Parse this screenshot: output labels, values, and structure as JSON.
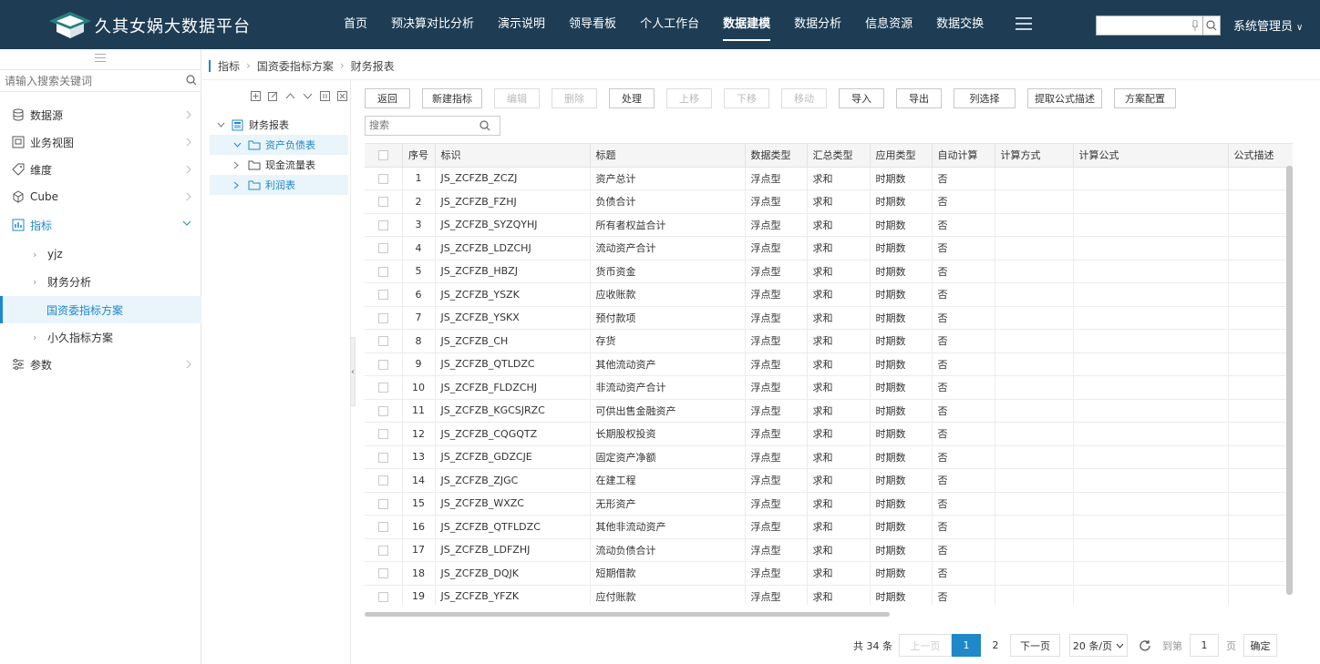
{
  "app": {
    "title": "久其女娲大数据平台"
  },
  "nav": {
    "items": [
      "首页",
      "预决算对比分析",
      "演示说明",
      "领导看板",
      "个人工作台",
      "数据建模",
      "数据分析",
      "信息资源",
      "数据交换"
    ]
  },
  "header": {
    "search_placeholder": "",
    "user": "系统管理员"
  },
  "sidebar": {
    "search_placeholder": "请输入搜索关键词",
    "items": [
      "数据源",
      "业务视图",
      "维度",
      "Cube",
      "指标",
      "参数"
    ],
    "subitems": [
      "yjz",
      "财务分析",
      "国资委指标方案",
      "小久指标方案"
    ]
  },
  "breadcrumb": [
    "指标",
    "国资委指标方案",
    "财务报表"
  ],
  "tree": {
    "root": "财务报表",
    "children": [
      "资产负债表",
      "现金流量表",
      "利润表"
    ]
  },
  "toolbar": {
    "buttons": [
      "返回",
      "新建指标",
      "编辑",
      "删除",
      "处理",
      "上移",
      "下移",
      "移动",
      "导入",
      "导出",
      "列选择",
      "提取公式描述",
      "方案配置"
    ]
  },
  "grid_search_placeholder": "搜索",
  "table": {
    "columns": [
      "序号",
      "标识",
      "标题",
      "数据类型",
      "汇总类型",
      "应用类型",
      "自动计算",
      "计算方式",
      "计算公式",
      "公式描述"
    ],
    "rows": [
      [
        "1",
        "JS_ZCFZB_ZCZJ",
        "资产总计",
        "浮点型",
        "求和",
        "时期数",
        "否",
        "",
        "",
        ""
      ],
      [
        "2",
        "JS_ZCFZB_FZHJ",
        "负债合计",
        "浮点型",
        "求和",
        "时期数",
        "否",
        "",
        "",
        ""
      ],
      [
        "3",
        "JS_ZCFZB_SYZQYHJ",
        "所有者权益合计",
        "浮点型",
        "求和",
        "时期数",
        "否",
        "",
        "",
        ""
      ],
      [
        "4",
        "JS_ZCFZB_LDZCHJ",
        "流动资产合计",
        "浮点型",
        "求和",
        "时期数",
        "否",
        "",
        "",
        ""
      ],
      [
        "5",
        "JS_ZCFZB_HBZJ",
        "货币资金",
        "浮点型",
        "求和",
        "时期数",
        "否",
        "",
        "",
        ""
      ],
      [
        "6",
        "JS_ZCFZB_YSZK",
        "应收账款",
        "浮点型",
        "求和",
        "时期数",
        "否",
        "",
        "",
        ""
      ],
      [
        "7",
        "JS_ZCFZB_YSKX",
        "预付款项",
        "浮点型",
        "求和",
        "时期数",
        "否",
        "",
        "",
        ""
      ],
      [
        "8",
        "JS_ZCFZB_CH",
        "存货",
        "浮点型",
        "求和",
        "时期数",
        "否",
        "",
        "",
        ""
      ],
      [
        "9",
        "JS_ZCFZB_QTLDZC",
        "其他流动资产",
        "浮点型",
        "求和",
        "时期数",
        "否",
        "",
        "",
        ""
      ],
      [
        "10",
        "JS_ZCFZB_FLDZCHJ",
        "非流动资产合计",
        "浮点型",
        "求和",
        "时期数",
        "否",
        "",
        "",
        ""
      ],
      [
        "11",
        "JS_ZCFZB_KGCSJRZC",
        "可供出售金融资产",
        "浮点型",
        "求和",
        "时期数",
        "否",
        "",
        "",
        ""
      ],
      [
        "12",
        "JS_ZCFZB_CQGQTZ",
        "长期股权投资",
        "浮点型",
        "求和",
        "时期数",
        "否",
        "",
        "",
        ""
      ],
      [
        "13",
        "JS_ZCFZB_GDZCJE",
        "固定资产净额",
        "浮点型",
        "求和",
        "时期数",
        "否",
        "",
        "",
        ""
      ],
      [
        "14",
        "JS_ZCFZB_ZJGC",
        "在建工程",
        "浮点型",
        "求和",
        "时期数",
        "否",
        "",
        "",
        ""
      ],
      [
        "15",
        "JS_ZCFZB_WXZC",
        "无形资产",
        "浮点型",
        "求和",
        "时期数",
        "否",
        "",
        "",
        ""
      ],
      [
        "16",
        "JS_ZCFZB_QTFLDZC",
        "其他非流动资产",
        "浮点型",
        "求和",
        "时期数",
        "否",
        "",
        "",
        ""
      ],
      [
        "17",
        "JS_ZCFZB_LDFZHJ",
        "流动负债合计",
        "浮点型",
        "求和",
        "时期数",
        "否",
        "",
        "",
        ""
      ],
      [
        "18",
        "JS_ZCFZB_DQJK",
        "短期借款",
        "浮点型",
        "求和",
        "时期数",
        "否",
        "",
        "",
        ""
      ],
      [
        "19",
        "JS_ZCFZB_YFZK",
        "应付账款",
        "浮点型",
        "求和",
        "时期数",
        "否",
        "",
        "",
        ""
      ]
    ]
  },
  "pager": {
    "total": "共 34 条",
    "prev": "上一页",
    "pages": [
      "1",
      "2"
    ],
    "next": "下一页",
    "size": "20 条/页",
    "goto": "到第",
    "goto_value": "1",
    "page_unit": "页",
    "confirm": "确定"
  },
  "colors": {
    "topbar": "#1e3d55",
    "accent": "#1e88c8"
  }
}
